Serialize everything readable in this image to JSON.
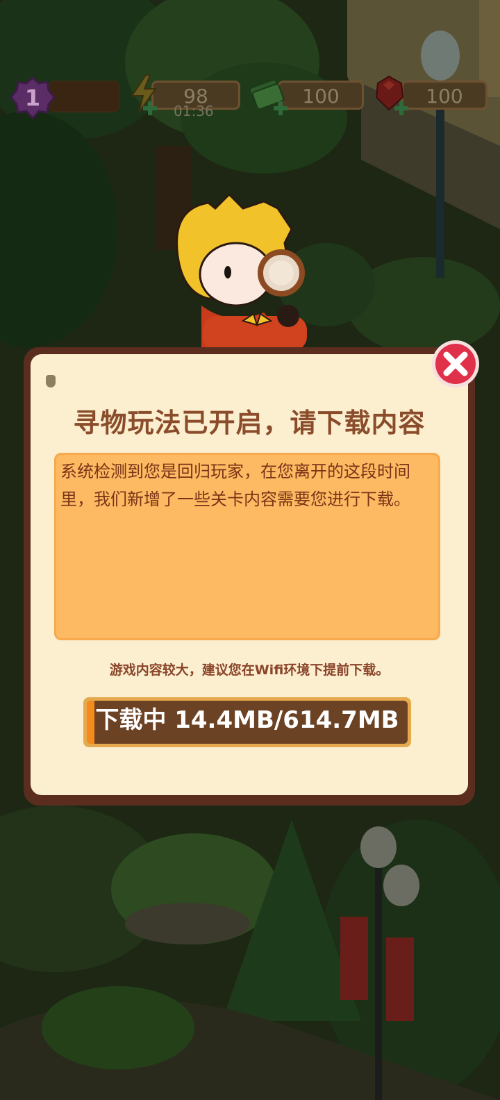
{
  "hud": {
    "level": "1",
    "energy": "98",
    "energy_timer": "01:36",
    "cash": "100",
    "gems": "100"
  },
  "dialog": {
    "title": "寻物玩法已开启，请下载内容",
    "message": "系统检测到您是回归玩家，在您离开的这段时间里，我们新增了一些关卡内容需要您进行下载。",
    "hint": "游戏内容较大，建议您在Wifi环境下提前下载。",
    "progress_text": "下载中  14.4MB/614.7MB",
    "progress_fraction": 0.0234
  },
  "icons": {
    "close": "close-icon",
    "energy": "lightning-icon",
    "cash": "cash-icon",
    "gem": "ruby-icon",
    "level": "level-badge-icon"
  },
  "colors": {
    "dialog_border": "#5a2d1e",
    "dialog_bg": "#fbefd0",
    "title": "#8a4c2a",
    "message_bg": "#fdba63",
    "progress_fill": "#f68b1d",
    "close_red": "#e0314a"
  }
}
